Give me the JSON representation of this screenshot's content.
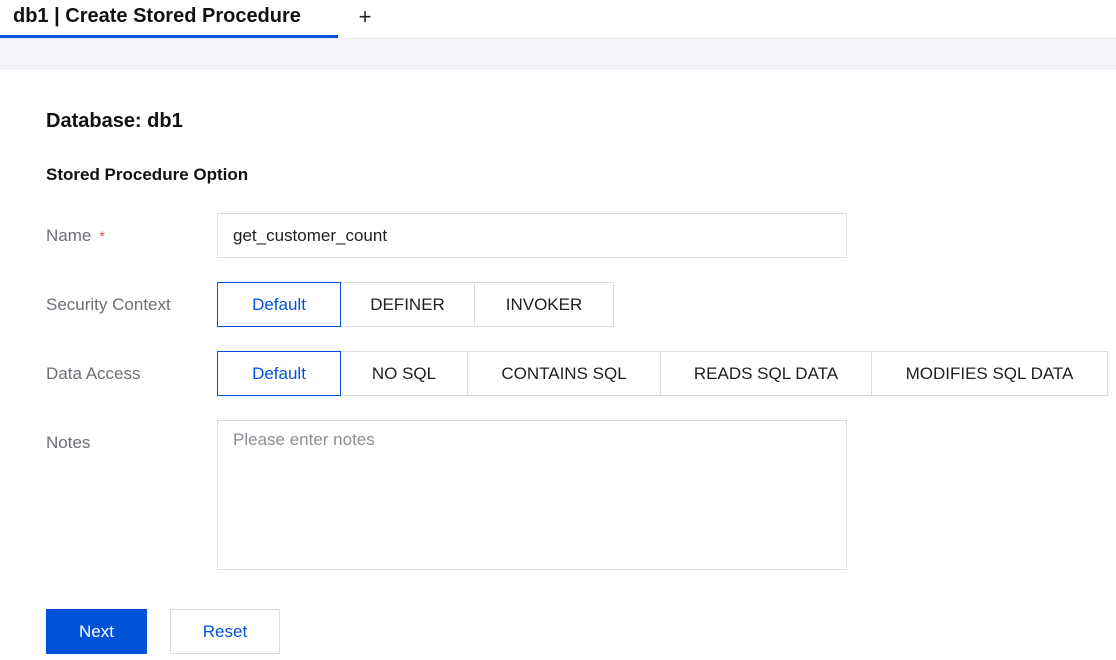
{
  "tabs": [
    {
      "label": "db1 | Create Stored Procedure",
      "active": true
    }
  ],
  "add_tab_label": "+",
  "database_heading": "Database: db1",
  "section_title": "Stored Procedure Option",
  "form": {
    "name": {
      "label": "Name",
      "required_mark": "*",
      "value": "get_customer_count"
    },
    "security_context": {
      "label": "Security Context",
      "options": [
        "Default",
        "DEFINER",
        "INVOKER"
      ],
      "selected": "Default"
    },
    "data_access": {
      "label": "Data Access",
      "options": [
        "Default",
        "NO SQL",
        "CONTAINS SQL",
        "READS SQL DATA",
        "MODIFIES SQL DATA"
      ],
      "selected": "Default"
    },
    "notes": {
      "label": "Notes",
      "placeholder": "Please enter notes",
      "value": ""
    }
  },
  "actions": {
    "next_label": "Next",
    "reset_label": "Reset"
  },
  "colors": {
    "accent": "#0052d9",
    "required": "#e34d59",
    "label_gray": "#6b6f76",
    "border": "#dcdcdc",
    "strip_bg": "#f3f4f7"
  }
}
